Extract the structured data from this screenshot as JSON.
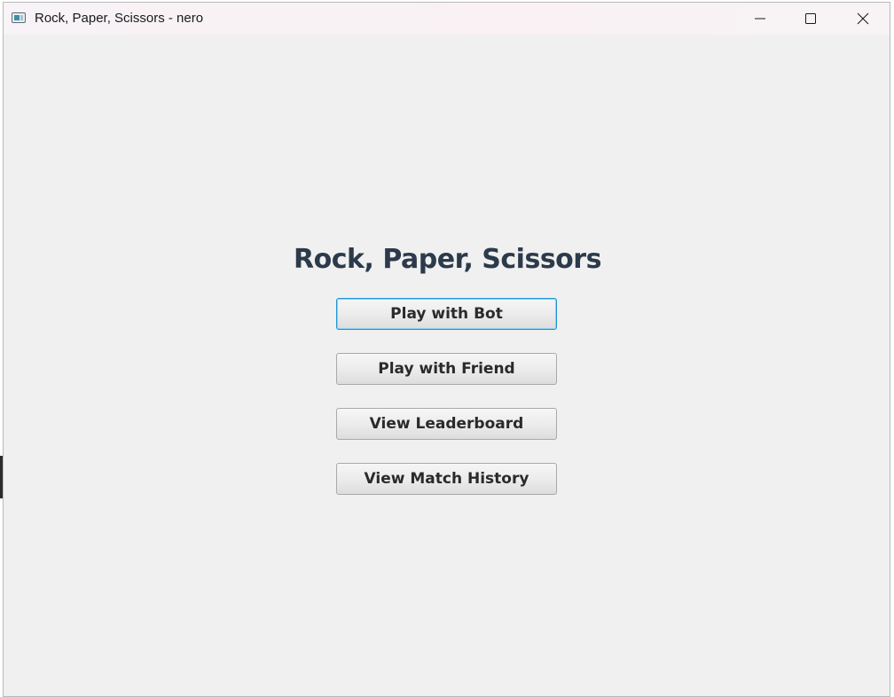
{
  "window": {
    "title": "Rock, Paper, Scissors - nero",
    "controls": {
      "minimize": "minimize-icon",
      "maximize": "maximize-icon",
      "close": "close-icon"
    }
  },
  "main": {
    "heading": "Rock, Paper, Scissors",
    "buttons": [
      {
        "label": "Play with Bot",
        "focused": true
      },
      {
        "label": "Play with Friend",
        "focused": false
      },
      {
        "label": "View Leaderboard",
        "focused": false
      },
      {
        "label": "View Match History",
        "focused": false
      }
    ]
  },
  "colors": {
    "heading": "#2c3a4b",
    "focus_ring": "#1e95d4",
    "background": "#f0f0f0"
  }
}
